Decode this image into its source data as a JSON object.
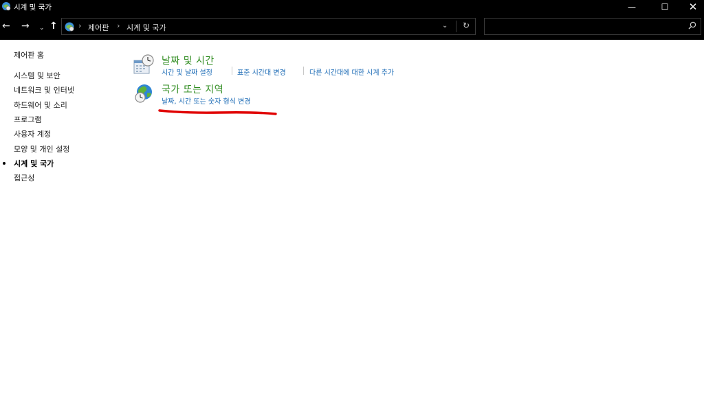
{
  "window": {
    "title": "시계 및 국가",
    "minimize_glyph": "—",
    "maximize_glyph": "☐",
    "close_glyph": "✕"
  },
  "navigation": {
    "back_glyph": "←",
    "forward_glyph": "→",
    "recent_glyph": "⌄",
    "up_glyph": "↑"
  },
  "address": {
    "breadcrumb": [
      "제어판",
      "시계 및 국가"
    ],
    "separator": "›",
    "dropdown_glyph": "⌄",
    "refresh_glyph": "↻"
  },
  "search": {
    "placeholder": "",
    "icon": "search-icon"
  },
  "sidebar": {
    "home": "제어판 홈",
    "items": [
      {
        "label": "시스템 및 보안",
        "active": false
      },
      {
        "label": "네트워크 및 인터넷",
        "active": false
      },
      {
        "label": "하드웨어 및 소리",
        "active": false
      },
      {
        "label": "프로그램",
        "active": false
      },
      {
        "label": "사용자 계정",
        "active": false
      },
      {
        "label": "모양 및 개인 설정",
        "active": false
      },
      {
        "label": "시계 및 국가",
        "active": true
      },
      {
        "label": "접근성",
        "active": false
      }
    ]
  },
  "main": {
    "categories": [
      {
        "title": "날짜 및 시간",
        "icon": "calendar-clock-icon",
        "links": [
          "시간 및 날짜 설정",
          "표준 시간대 변경",
          "다른 시간대에 대한 시계 추가"
        ]
      },
      {
        "title": "국가 또는 지역",
        "icon": "globe-clock-icon",
        "links": [
          "날짜, 시간 또는 숫자 형식 변경"
        ],
        "annotation": "red-hand-drawn-underline"
      }
    ]
  },
  "colors": {
    "titlebar_bg": "#000000",
    "category_title": "#2e8b1e",
    "link": "#1a6ab5",
    "annotation": "#e00000"
  }
}
